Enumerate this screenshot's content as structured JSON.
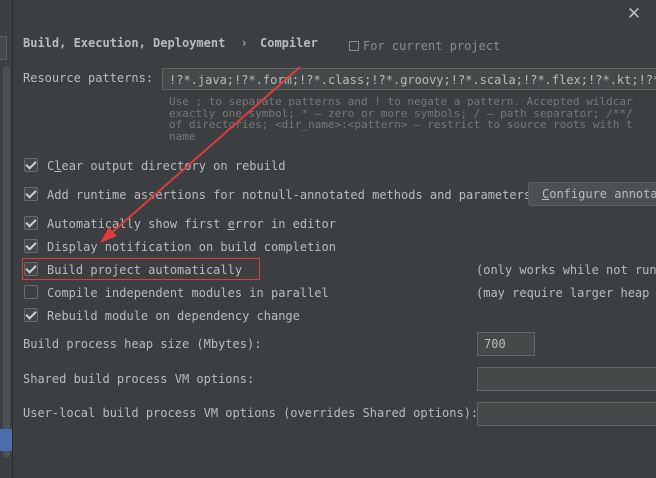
{
  "breadcrumb": {
    "section": "Build, Execution, Deployment",
    "separator": "›",
    "page": "Compiler"
  },
  "scope_label": "For current project",
  "resource_patterns": {
    "label": "Resource patterns:",
    "value": "!?*.java;!?*.form;!?*.class;!?*.groovy;!?*.scala;!?*.flex;!?*.kt;!?*.c",
    "hint_lines": [
      "Use ; to separate patterns and ! to negate a pattern. Accepted wildcar",
      "exactly one symbol; * — zero or more symbols; / — path separator; /**/",
      "of directories; <dir_name>:<pattern> — restrict to source roots with t",
      "name"
    ]
  },
  "options": {
    "clear_output": {
      "pre": "C",
      "u": "l",
      "post": "ear output directory on rebuild",
      "checked": true
    },
    "runtime_assertions": {
      "label": "Add runtime assertions for notnull-annotated methods and parameters",
      "checked": true
    },
    "configure_button": {
      "pre": "",
      "u": "C",
      "post": "onfigure annotat"
    },
    "show_first_error": {
      "pre": "Automatically show first ",
      "u": "e",
      "post": "rror in editor",
      "checked": true
    },
    "display_notification": {
      "label": "Display notification on build completion",
      "checked": true
    },
    "build_automatically": {
      "label": "Build project automatically",
      "checked": true
    },
    "build_automatically_note": "(only works while not runn",
    "compile_parallel": {
      "label": "Compile independent modules in parallel",
      "checked": false
    },
    "compile_parallel_note": "(may require larger heap s",
    "rebuild_on_dependency": {
      "label": "Rebuild module on dependency change",
      "checked": true
    }
  },
  "heap_size": {
    "label": "Build process heap size (Mbytes):",
    "value": "700"
  },
  "shared_vm": {
    "label": "Shared build process VM options:",
    "value": ""
  },
  "user_local_vm": {
    "label": "User-local build process VM options (overrides Shared options):",
    "value": ""
  },
  "colors": {
    "background": "#3c3f41",
    "highlight_box": "#e03c3c",
    "arrow": "#e03c3c"
  },
  "icons": {
    "close": "close-icon",
    "scope": "scope-icon",
    "checkbox": "checkbox-icon"
  }
}
